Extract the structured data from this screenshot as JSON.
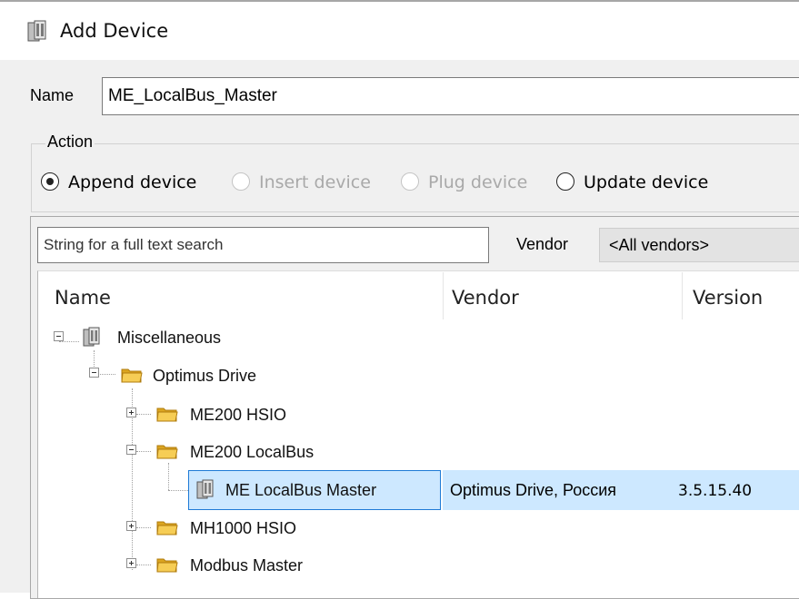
{
  "dialog": {
    "title": "Add Device",
    "title_icon": "device-icon"
  },
  "name_field": {
    "label": "Name",
    "value": "ME_LocalBus_Master"
  },
  "action": {
    "legend": "Action",
    "options": [
      {
        "label": "Append device",
        "selected": true,
        "enabled": true
      },
      {
        "label": "Insert device",
        "selected": false,
        "enabled": false
      },
      {
        "label": "Plug device",
        "selected": false,
        "enabled": false
      },
      {
        "label": "Update device",
        "selected": false,
        "enabled": true
      }
    ]
  },
  "search": {
    "placeholder": "String for a full text search",
    "vendor_label": "Vendor",
    "vendor_selected": "<All vendors>"
  },
  "tree": {
    "columns": [
      "Name",
      "Vendor",
      "Version"
    ],
    "nodes": [
      {
        "label": "Miscellaneous",
        "icon": "device-icon",
        "expander": "minus"
      },
      {
        "label": "Optimus Drive",
        "icon": "folder-icon",
        "expander": "minus"
      },
      {
        "label": "ME200 HSIO",
        "icon": "folder-icon",
        "expander": "plus"
      },
      {
        "label": "ME200 LocalBus",
        "icon": "folder-icon",
        "expander": "minus"
      },
      {
        "label": "ME LocalBus Master",
        "icon": "device-icon",
        "vendor": "Optimus Drive, Россия",
        "version": "3.5.15.40",
        "selected": true
      },
      {
        "label": "MH1000 HSIO",
        "icon": "folder-icon",
        "expander": "plus"
      },
      {
        "label": "Modbus Master",
        "icon": "folder-icon",
        "expander": "plus"
      }
    ]
  },
  "colors": {
    "selection_bg": "#cde8ff",
    "selection_border": "#1e7ad6",
    "panel_bg": "#f0f0f0",
    "folder_yellow": "#f2c244"
  }
}
